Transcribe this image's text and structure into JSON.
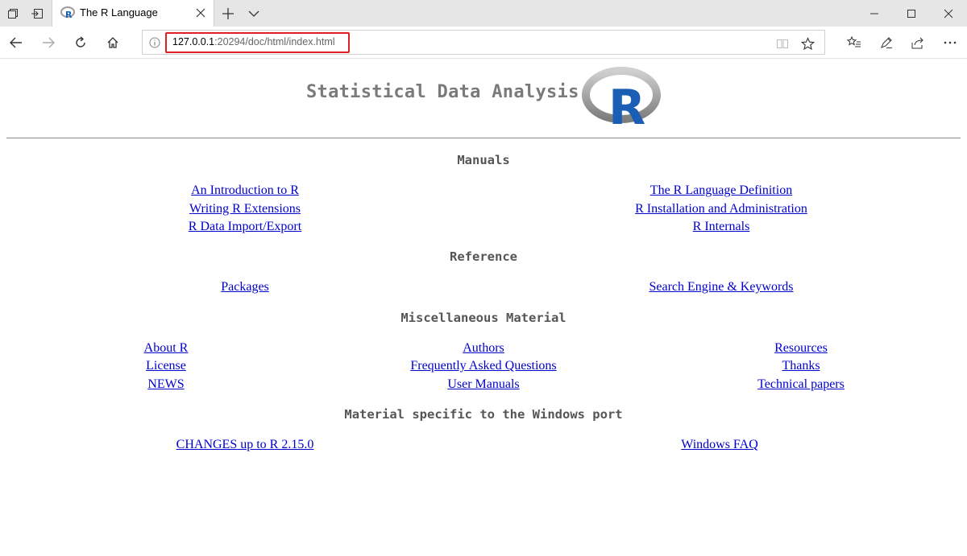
{
  "browser": {
    "tab": {
      "title": "The R Language"
    },
    "address": {
      "host": "127.0.0.1",
      "rest": ":20294/doc/html/index.html"
    }
  },
  "page": {
    "heading": "Statistical Data Analysis",
    "logo_letter": "R",
    "sections": {
      "manuals": {
        "title": "Manuals",
        "links": [
          "An Introduction to R",
          "The R Language Definition",
          "Writing R Extensions",
          "R Installation and Administration",
          "R Data Import/Export",
          "R Internals"
        ]
      },
      "reference": {
        "title": "Reference",
        "links": [
          "Packages",
          "Search Engine & Keywords"
        ]
      },
      "misc": {
        "title": "Miscellaneous Material",
        "links": [
          "About R",
          "Authors",
          "Resources",
          "License",
          "Frequently Asked Questions",
          "Thanks",
          "NEWS",
          "User Manuals",
          "Technical papers"
        ]
      },
      "windows": {
        "title": "Material specific to the Windows port",
        "links": [
          "CHANGES up to R 2.15.0",
          "Windows FAQ"
        ]
      }
    }
  },
  "colors": {
    "link": "#0000cc",
    "heading": "#7a7a7a",
    "logo_blue": "#1a5fb4",
    "highlight": "#e02020"
  }
}
